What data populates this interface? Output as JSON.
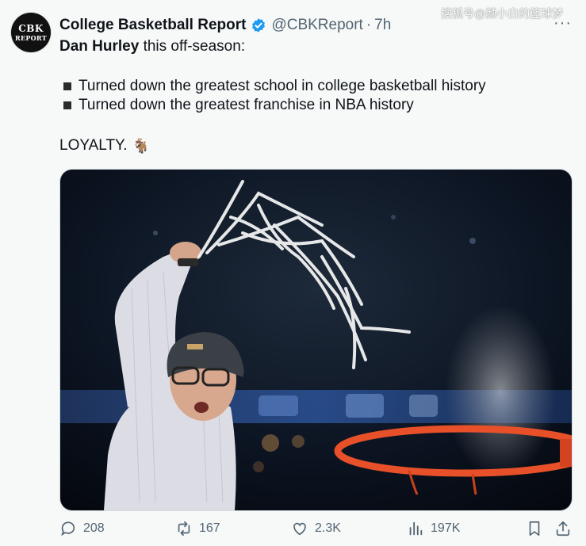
{
  "account": {
    "avatar_line1": "CBK",
    "avatar_line2": "REPORT",
    "display_name": "College Basketball Report",
    "handle": "@CBKReport",
    "separator": "·",
    "time": "7h"
  },
  "watermark": "搜狐号@颜小白的篮球梦",
  "more_label": "···",
  "tweet": {
    "name": "Dan Hurley",
    "line1_rest": " this off-season:",
    "bullets": [
      "Turned down the greatest school in college basketball history",
      "Turned down the greatest franchise in NBA history"
    ],
    "loyalty": "LOYALTY.",
    "emoji": "🐐"
  },
  "actions": {
    "replies": "208",
    "reposts": "167",
    "likes": "2.3K",
    "views": "197K"
  },
  "colors": {
    "verified": "#1d9bf0",
    "secondary_text": "#536471",
    "rim": "#e8502a"
  },
  "icons": [
    "reply-icon",
    "repost-icon",
    "like-icon",
    "views-icon",
    "bookmark-icon",
    "share-icon",
    "verified-badge-icon",
    "more-icon"
  ]
}
